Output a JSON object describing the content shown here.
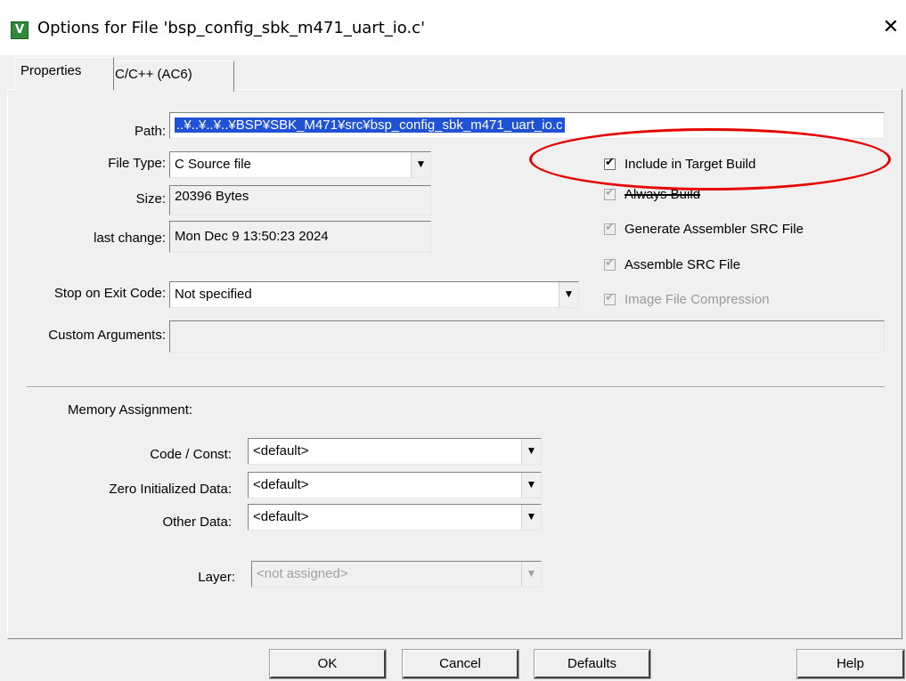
{
  "window": {
    "title": "Options for File 'bsp_config_sbk_m471_uart_io.c'",
    "icon_glyph": "V",
    "close_glyph": "✕"
  },
  "tabs": [
    {
      "label": "Properties",
      "active": true
    },
    {
      "label": "C/C++ (AC6)",
      "active": false
    }
  ],
  "fields": {
    "path": {
      "label": "Path:",
      "value": "..¥..¥..¥..¥BSP¥SBK_M471¥src¥bsp_config_sbk_m471_uart_io.c"
    },
    "file_type": {
      "label": "File Type:",
      "value": "C Source file"
    },
    "size": {
      "label": "Size:",
      "value": "20396 Bytes"
    },
    "last_change": {
      "label": "last change:",
      "value": "Mon Dec  9 13:50:23 2024"
    },
    "stop_on_exit": {
      "label": "Stop on Exit Code:",
      "value": "Not specified"
    },
    "custom_args": {
      "label": "Custom Arguments:",
      "value": ""
    }
  },
  "checkboxes": [
    {
      "label": "Include in Target Build",
      "checked": true,
      "enabled": true
    },
    {
      "label": "Always Build",
      "checked": true,
      "enabled": false
    },
    {
      "label": "Generate Assembler SRC File",
      "checked": true,
      "enabled": false
    },
    {
      "label": "Assemble SRC File",
      "checked": true,
      "enabled": false
    },
    {
      "label": "Image File Compression",
      "checked": true,
      "enabled": false
    }
  ],
  "memory": {
    "heading": "Memory Assignment:",
    "code_const": {
      "label": "Code / Const:",
      "value": "<default>"
    },
    "zero_init": {
      "label": "Zero Initialized Data:",
      "value": "<default>"
    },
    "other": {
      "label": "Other Data:",
      "value": "<default>"
    },
    "layer": {
      "label": "Layer:",
      "value": "<not assigned>"
    }
  },
  "buttons": {
    "ok": "OK",
    "cancel": "Cancel",
    "defaults": "Defaults",
    "help": "Help"
  },
  "annotation_color": "#e60000",
  "highlight_color": "#1f52d4"
}
